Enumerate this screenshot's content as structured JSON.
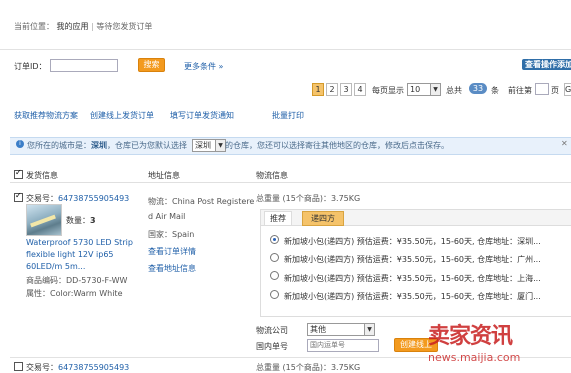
{
  "breadcrumb": {
    "location_label": "当前位置：",
    "app": "我的应用",
    "sep": "|",
    "current": "等待您发货订单"
  },
  "search": {
    "order_id_label": "订单ID：",
    "order_id_value": "",
    "search_button": "搜索",
    "more_conditions": "更多条件 »",
    "view_log_button": "查看操作添加"
  },
  "pagination": {
    "pages": [
      "1",
      "2",
      "3",
      "4"
    ],
    "per_page_label": "每页显示",
    "per_page_value": "10",
    "total_prefix": "总共",
    "total_value": "33",
    "total_suffix": "条",
    "goto_label": "前往第",
    "goto_suffix": "页",
    "goto_button": "G"
  },
  "actions": {
    "recommend": "获取推荐物流方案",
    "create_ship": "创建线上发货订单",
    "fill_notice": "填写订单发货通知",
    "batch_print": "批量打印"
  },
  "notice": {
    "text_a": "您所在的城市是：",
    "city": "深圳",
    "text_b": "，仓库已为您默认选择",
    "select_value": "深圳",
    "text_c": "的仓库，您还可以选择寄往其他地区的仓库，修改后点击保存。",
    "close": "✕"
  },
  "columns": {
    "ship_info": "发货信息",
    "address": "地址信息",
    "logistics": "物流信息"
  },
  "order": {
    "id_label": "交易号：",
    "id_value": "64738755905493",
    "qty_label": "数量：",
    "qty_value": "3",
    "title": "Waterproof 5730 LED Strip flexible light 12V ip65 60LED/m 5m...",
    "sku_label": "商品编码：",
    "sku_value": "DD-5730-F-WW",
    "attr_label": "属性：",
    "attr_value": "Color:Warm White",
    "address_lines": [
      "物流：China Post Registere",
      "d Air Mail",
      "国家：Spain"
    ],
    "view_detail": "查看订单详情",
    "view_address": "查看地址信息",
    "weight_text": "总重量 (15个商品)：3.75KG",
    "tabs": [
      "推荐",
      "递四方"
    ],
    "options": [
      "新加坡小包(递四方) 预估运费：¥35.50元，15-60天, 仓库地址：深圳...",
      "新加坡小包(递四方) 预估运费：¥35.50元，15-60天, 仓库地址：广州...",
      "新加坡小包(递四方) 预估运费：¥35.50元，15-60天, 仓库地址：上海...",
      "新加坡小包(递四方) 预估运费：¥35.50元，15-60天, 仓库地址：厦门..."
    ],
    "carrier_label": "物流公司",
    "carrier_value": "其他",
    "tracking_label": "国内单号",
    "tracking_placeholder": "国内运单号",
    "create_button": "创建线上"
  },
  "order2": {
    "id_label": "交易号：",
    "id_value": "64738755905493",
    "weight_text": "总重量 (15个商品)：3.75KG"
  },
  "watermark": {
    "title": "卖家资讯",
    "url": "news.maijia.com"
  },
  "colors": {
    "accent": "#f39a1e",
    "link": "#1f5fa8",
    "notice_bg": "#e8f1fb",
    "tab_active": "#f5c36a"
  }
}
